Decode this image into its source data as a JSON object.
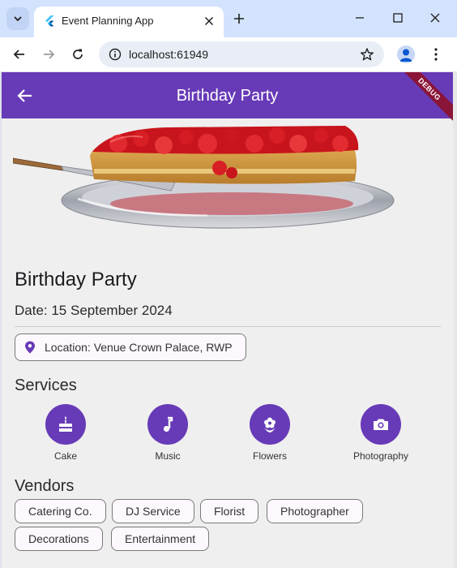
{
  "browser": {
    "tab_title": "Event Planning App",
    "url": "localhost:61949"
  },
  "app": {
    "appbar_title": "Birthday Party",
    "debug_banner": "DEBUG",
    "event_title": "Birthday Party",
    "date": "Date: 15 September 2024",
    "location": "Location: Venue Crown Palace, RWP",
    "services_title": "Services",
    "services": [
      {
        "label": "Cake",
        "icon": "cake-icon"
      },
      {
        "label": "Music",
        "icon": "music-note-icon"
      },
      {
        "label": "Flowers",
        "icon": "flower-icon"
      },
      {
        "label": "Photography",
        "icon": "camera-icon"
      }
    ],
    "vendors_title": "Vendors",
    "vendors": [
      "Catering Co.",
      "DJ Service",
      "Florist",
      "Photographer",
      "Decorations",
      "Entertainment"
    ]
  },
  "colors": {
    "primary": "#673ab7",
    "debug": "#8a1538",
    "background": "#efefef"
  }
}
